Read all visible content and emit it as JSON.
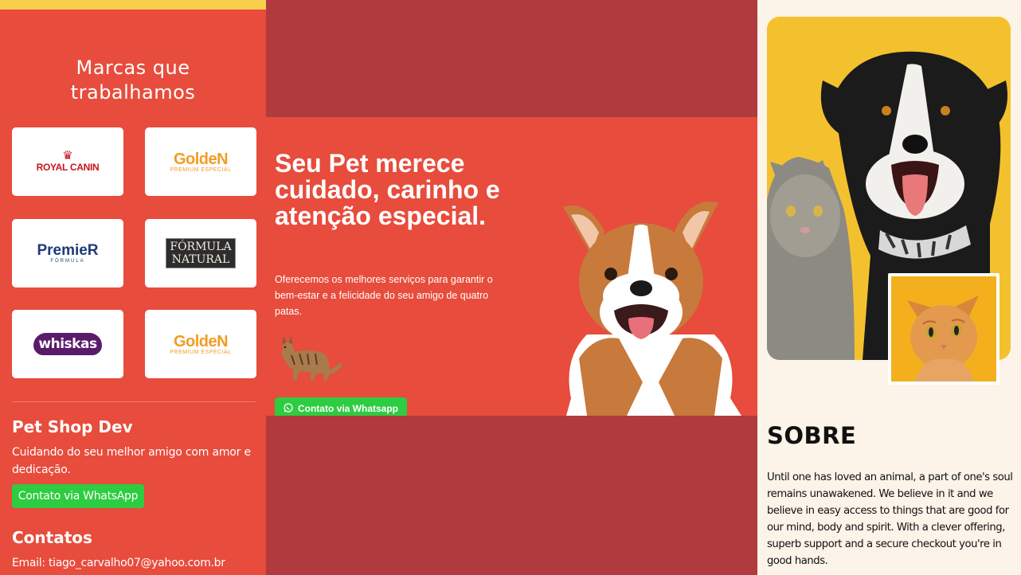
{
  "brands": {
    "title_line1": "Marcas que",
    "title_line2": "trabalhamos",
    "items": [
      {
        "name": "ROYAL CANIN",
        "sub": ""
      },
      {
        "name": "GoldeN",
        "sub": "PREMIUM ESPECIAL"
      },
      {
        "name": "PremieR",
        "sub": "FÓRMULA"
      },
      {
        "name_line1": "FÓRMULA",
        "name_line2": "NATURAL"
      },
      {
        "name": "whiskas"
      },
      {
        "name": "GoldeN",
        "sub": "PREMIUM ESPECIAL"
      }
    ]
  },
  "footer": {
    "shop_name": "Pet Shop Dev",
    "description": "Cuidando do seu melhor amigo com amor e dedicação.",
    "whatsapp_button": "Contato via WhatsApp",
    "contacts_title": "Contatos",
    "email": "Email: tiago_carvalho07@yahoo.com.br"
  },
  "hero": {
    "title": "Seu Pet merece cuidado, carinho e atenção especial.",
    "text": "Oferecemos os melhores serviços para garantir o bem-estar e a felicidade do seu amigo de quatro patas.",
    "whatsapp_button": "Contato via Whatsapp"
  },
  "about": {
    "title": "SOBRE",
    "text": "Until one has loved an animal, a part of one's soul remains unawakened. We believe in it and we believe in easy access to things that are good for our mind, body and spirit. With a clever offering, superb support and a secure checkout you're in good hands."
  },
  "colors": {
    "left_bg": "#e74c3c",
    "accent_yellow": "#f7cf4a",
    "middle_bg": "#b03a3e",
    "whatsapp_green": "#2ecc40",
    "about_bg": "#fcf3e9"
  },
  "icons": [
    "crown-icon",
    "whatsapp-icon"
  ]
}
